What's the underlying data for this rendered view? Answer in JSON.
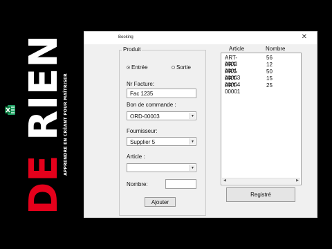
{
  "brand": {
    "word_de": "DE",
    "word_rien": "RIEN",
    "tagline": "APPRENDRE EN CRÉANT POUR MAÎTRISER",
    "icon": "excel-icon"
  },
  "window": {
    "title": "Booking",
    "close_icon": "close-icon",
    "group_title": "Produit",
    "radio_entree": "Entrée",
    "radio_sortie": "Sortie",
    "nr_facture_label": "Nr Facture:",
    "nr_facture_value": "Fac 1235",
    "bon_label": "Bon de commande :",
    "bon_value": "ORD-00003",
    "fournisseur_label": "Fournisseur:",
    "fournisseur_value": "Supplier 5",
    "article_label": "Article :",
    "article_value": "",
    "nombre_label": "Nombre:",
    "nombre_value": "",
    "ajouter_label": "Ajouter",
    "registre_label": "Registré",
    "list_headers": [
      "Article",
      "Nombre"
    ],
    "list_rows": [
      [
        "ART-0002",
        "56"
      ],
      [
        "ART-0001",
        "12"
      ],
      [
        "ART-00003",
        "50"
      ],
      [
        "ART-00004",
        "15"
      ],
      [
        "ART-00001",
        "25"
      ]
    ]
  }
}
